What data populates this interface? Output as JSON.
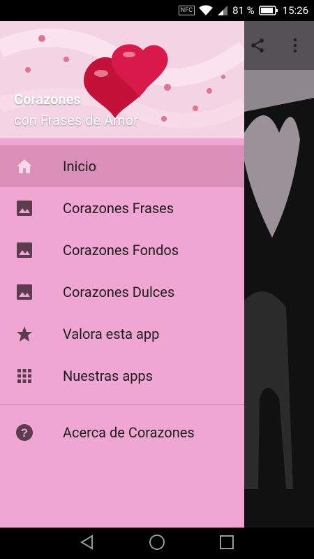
{
  "status_bar": {
    "battery": "81 %",
    "time": "15:26"
  },
  "header": {
    "title": "Corazones",
    "subtitle": "con Frases de Amor"
  },
  "menu": {
    "items": [
      {
        "label": "Inicio",
        "icon": "home-icon"
      },
      {
        "label": "Corazones Frases",
        "icon": "image-icon"
      },
      {
        "label": "Corazones Fondos",
        "icon": "image-icon"
      },
      {
        "label": "Corazones Dulces",
        "icon": "image-icon"
      },
      {
        "label": "Valora esta app",
        "icon": "star-icon"
      },
      {
        "label": "Nuestras apps",
        "icon": "grid-icon"
      }
    ],
    "secondary": [
      {
        "label": "Acerca de Corazones",
        "icon": "help-icon"
      }
    ]
  },
  "colors": {
    "drawer": "#efa6d2",
    "selected": "#d98fb7",
    "icon": "#5d3c4f"
  }
}
